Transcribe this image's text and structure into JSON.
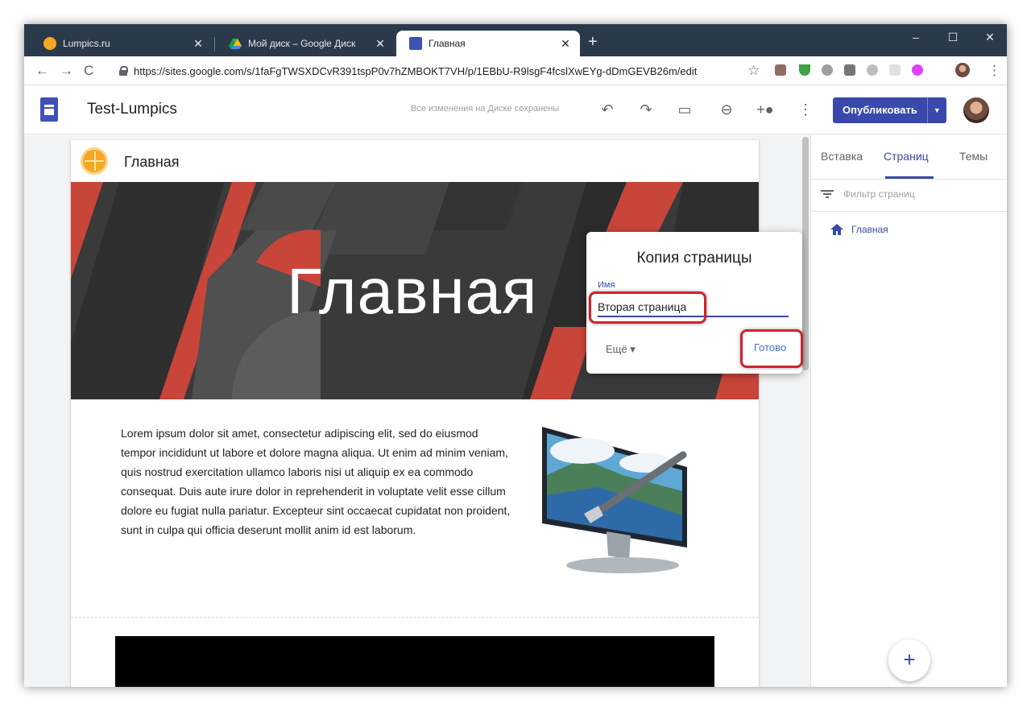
{
  "browser": {
    "tabs": [
      {
        "title": "Lumpics.ru",
        "icon": "lumpics-orange-icon"
      },
      {
        "title": "Мой диск – Google Диск",
        "icon": "google-drive-icon"
      },
      {
        "title": "Главная",
        "icon": "google-sites-icon"
      }
    ],
    "url": "https://sites.google.com/s/1faFgTWSXDCvR391tspP0v7hZMBOKT7VH/p/1EBbU-R9lsgF4fcslXwEYg-dDmGEVB26m/edit"
  },
  "toolbar": {
    "site_title": "Test-Lumpics",
    "saved_status": "Все изменения на Диске сохранены",
    "publish_label": "Опубликовать"
  },
  "page": {
    "header_name": "Главная",
    "hero_title": "Главная",
    "body_text": "Lorem ipsum dolor sit amet, consectetur adipiscing elit, sed do eiusmod tempor incididunt ut labore et dolore magna aliqua. Ut enim ad minim veniam, quis nostrud exercitation ullamco laboris nisi ut aliquip ex ea commodo consequat. Duis aute irure dolor in reprehenderit in voluptate velit esse cillum dolore eu fugiat nulla pariatur. Excepteur sint occaecat cupidatat non proident, sunt in culpa qui officia deserunt mollit anim id est laborum."
  },
  "panel": {
    "tabs": [
      "Вставка",
      "Страниц",
      "Темы"
    ],
    "active_tab": "Страниц",
    "filter_placeholder": "Фильтр страниц",
    "pages": [
      "Главная"
    ],
    "fab_label": "+"
  },
  "dialog": {
    "title": "Копия страницы",
    "name_label": "Имя",
    "name_value": "Вторая страница",
    "more_label": "Ещё ▾",
    "done_label": "Готово"
  },
  "colors": {
    "accent": "#3949ab",
    "highlight": "#d0222b",
    "hero_red": "#c8453a",
    "hero_dark": "#3a3a3a"
  }
}
